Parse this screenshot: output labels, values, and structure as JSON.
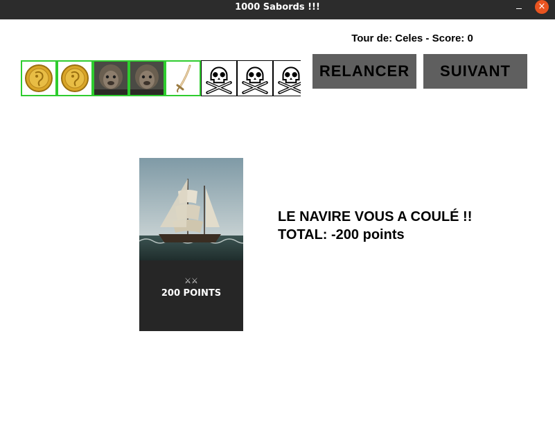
{
  "window": {
    "title": "1000 Sabords !!!",
    "minimize_glyph": "–",
    "close_glyph": "×",
    "close_color": "#e95420"
  },
  "status": {
    "text": "Tour de: Celes - Score: 0"
  },
  "dice": [
    {
      "face": "gold-coin",
      "kept": true
    },
    {
      "face": "gold-coin",
      "kept": true
    },
    {
      "face": "monkey",
      "kept": true
    },
    {
      "face": "monkey",
      "kept": true
    },
    {
      "face": "sabre",
      "kept": true
    },
    {
      "face": "skull",
      "kept": false
    },
    {
      "face": "skull",
      "kept": false
    },
    {
      "face": "skull",
      "kept": false
    }
  ],
  "colors": {
    "kept_border": "#2ecc2e",
    "button_bg": "#5f5f5f"
  },
  "buttons": {
    "reroll_label": "RELANCER",
    "next_label": "SUIVANT"
  },
  "card": {
    "points_label": "200 POINTS",
    "swords_glyph": "⚔⚔"
  },
  "result": {
    "line1": "LE NAVIRE VOUS A COULÉ !!",
    "line2": "TOTAL: -200 points"
  }
}
